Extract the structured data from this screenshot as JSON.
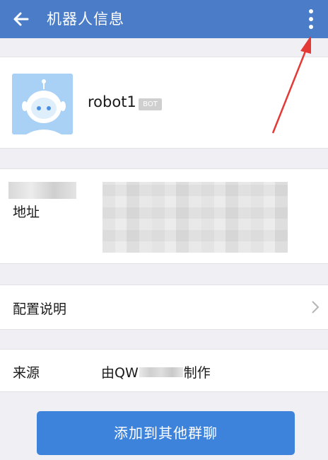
{
  "header": {
    "title": "机器人信息"
  },
  "profile": {
    "name": "robot1",
    "badge": "BOT"
  },
  "address": {
    "label": "地址"
  },
  "config": {
    "label": "配置说明"
  },
  "source": {
    "label": "来源",
    "value_prefix": "由QW",
    "value_suffix": "制作"
  },
  "actions": {
    "add_to_group": "添加到其他群聊"
  },
  "colors": {
    "header": "#4a7cc7",
    "button": "#3d83dc",
    "avatar_bg": "#a9d1f6",
    "annotation_arrow": "#e53935"
  },
  "icons": {
    "back": "arrow-left-icon",
    "more": "more-vertical-icon",
    "chevron": "chevron-right-icon"
  }
}
